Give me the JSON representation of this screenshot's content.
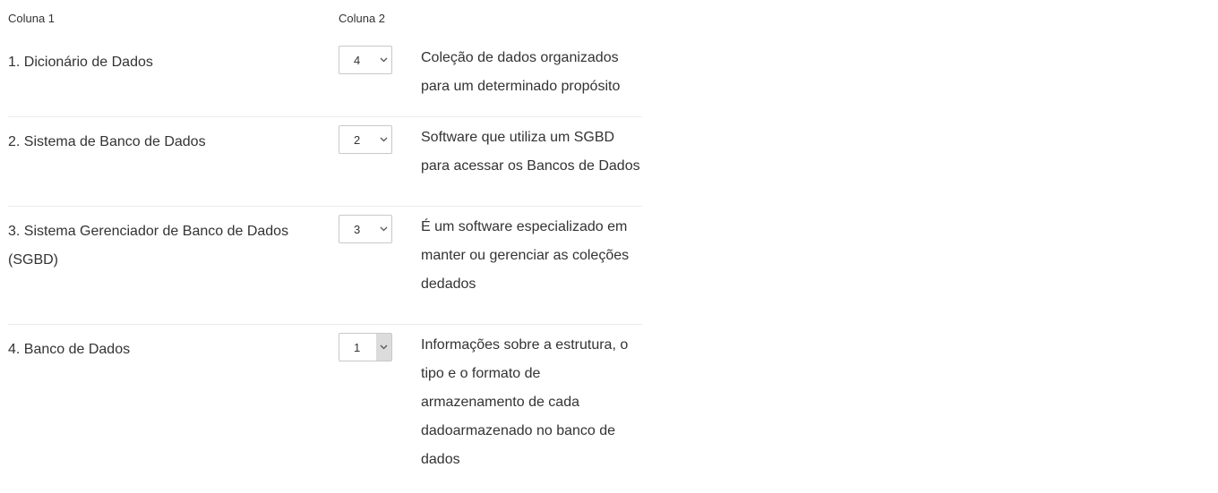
{
  "header": {
    "col1": "Coluna 1",
    "col2": "Coluna 2"
  },
  "rows": [
    {
      "term": "1. Dicionário de Dados",
      "selected": "4",
      "description": "Coleção de dados organizados para um determinado propósito"
    },
    {
      "term": "2. Sistema de Banco de Dados",
      "selected": "2",
      "description": "Software que utiliza um SGBD para acessar os Bancos de Dados"
    },
    {
      "term": "3. Sistema Gerenciador de Banco de Dados (SGBD)",
      "selected": "3",
      "description": "É um software especializado em manter ou gerenciar as coleções dedados"
    },
    {
      "term": "4. Banco de Dados",
      "selected": "1",
      "description": "Informações sobre a estrutura, o tipo e o formato de armazenamento de cada dadoarmazenado no banco de dados"
    }
  ]
}
